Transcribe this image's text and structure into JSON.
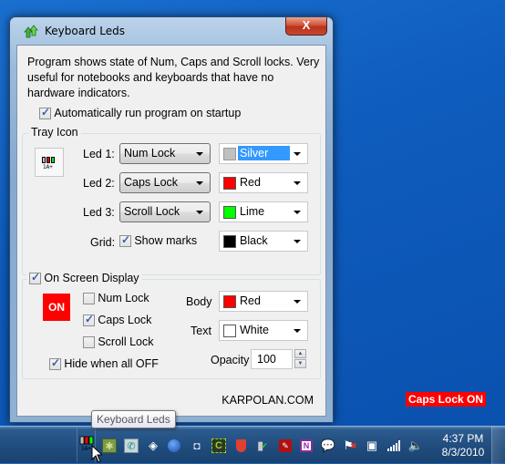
{
  "window": {
    "title": "Keyboard Leds",
    "close_label": "X",
    "description": "Program shows state of Num, Caps and Scroll locks. Very useful for notebooks and keyboards that have no hardware indicators.",
    "autorun": {
      "label": "Automatically run program on startup",
      "checked": true
    },
    "tray_icon": {
      "group_title": "Tray Icon",
      "preview_text": "1A+",
      "leds": [
        {
          "label": "Led 1:",
          "lock": "Num Lock",
          "color_name": "Silver",
          "color_hex": "#c0c0c0"
        },
        {
          "label": "Led 2:",
          "lock": "Caps Lock",
          "color_name": "Red",
          "color_hex": "#ff0000"
        },
        {
          "label": "Led 3:",
          "lock": "Scroll Lock",
          "color_name": "Lime",
          "color_hex": "#00ff00"
        }
      ],
      "grid": {
        "label": "Grid:",
        "show_marks_label": "Show marks",
        "show_marks_checked": true,
        "color_name": "Black",
        "color_hex": "#000000"
      }
    },
    "osd": {
      "group_title": "On Screen Display",
      "enabled": true,
      "preview_text": "ON",
      "locks": [
        {
          "label": "Num Lock",
          "checked": false
        },
        {
          "label": "Caps Lock",
          "checked": true
        },
        {
          "label": "Scroll Lock",
          "checked": false
        }
      ],
      "hide_all_off": {
        "label": "Hide when all OFF",
        "checked": true
      },
      "body": {
        "label": "Body",
        "color_name": "Red",
        "color_hex": "#ff0000"
      },
      "text": {
        "label": "Text",
        "color_name": "White",
        "color_hex": "#ffffff"
      },
      "opacity": {
        "label": "Opacity",
        "value": "100"
      }
    },
    "footer_link": "KARPOLAN.COM"
  },
  "tooltip": "Keyboard Leds",
  "osd_popup": "Caps Lock ON",
  "taskbar": {
    "clock_time": "4:37 PM",
    "clock_date": "8/3/2010",
    "tray_icons": [
      "keyboard-leds-icon",
      "puzzle-icon",
      "phone-icon",
      "paint-icon",
      "globe-icon",
      "camera-icon",
      "c-app-icon",
      "shield-icon",
      "usb-icon",
      "acrobat-icon",
      "onenote-icon",
      "chat-icon",
      "action-center-icon",
      "power-icon",
      "signal-icon",
      "volume-icon"
    ]
  }
}
